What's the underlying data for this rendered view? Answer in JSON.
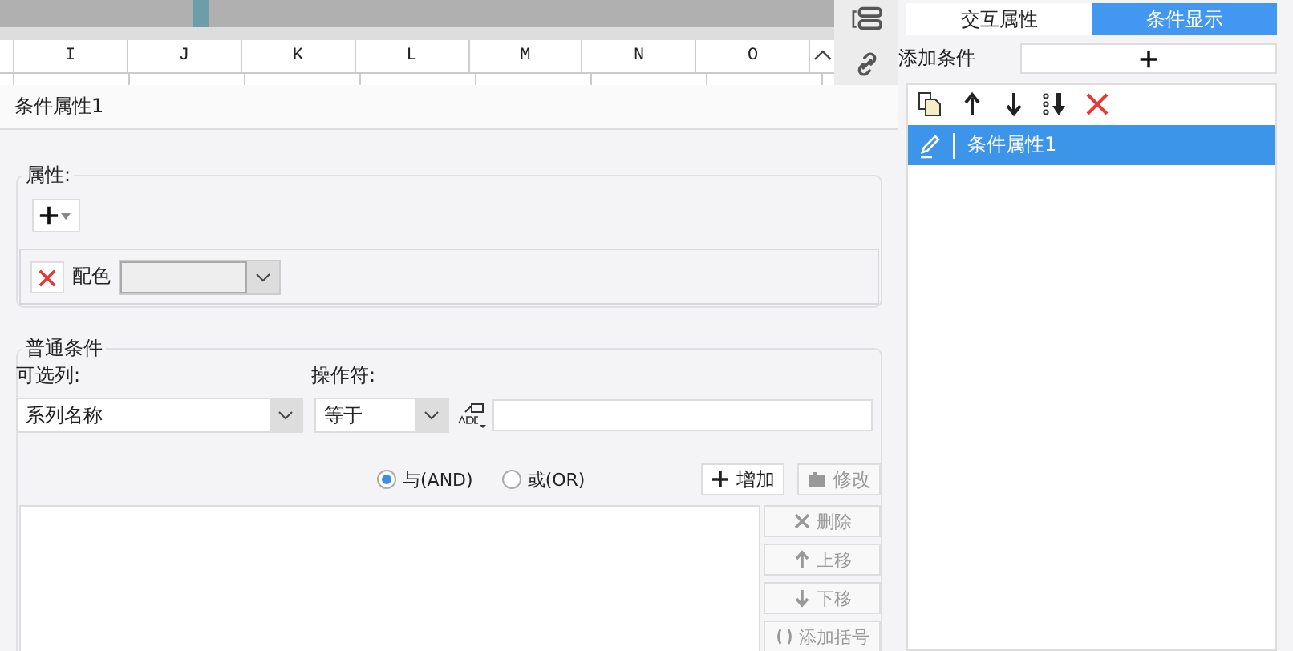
{
  "spreadsheet": {
    "columns": [
      "I",
      "J",
      "K",
      "L",
      "M",
      "N",
      "O"
    ]
  },
  "editor": {
    "title": "条件属性1",
    "attributes": {
      "legend": "属性:",
      "items": [
        {
          "name": "配色"
        }
      ]
    },
    "common_condition": {
      "legend": "普通条件",
      "column_label": "可选列:",
      "column_value": "系列名称",
      "operator_label": "操作符:",
      "operator_value": "等于",
      "logic": [
        {
          "label": "与(AND)",
          "selected": true
        },
        {
          "label": "或(OR)",
          "selected": false
        }
      ],
      "buttons": [
        {
          "label": "增加",
          "kind": "plus",
          "disabled": false
        },
        {
          "label": "修改",
          "kind": "block",
          "disabled": true
        }
      ],
      "list_buttons": [
        {
          "label": "删除",
          "kind": "cross",
          "disabled": true
        },
        {
          "label": "上移",
          "kind": "up",
          "disabled": true
        },
        {
          "label": "下移",
          "kind": "down",
          "disabled": true
        },
        {
          "label": "添加括号",
          "kind": "brackets",
          "disabled": true
        }
      ]
    }
  },
  "right_panel": {
    "tabs": [
      {
        "label": "交互属性",
        "selected": false
      },
      {
        "label": "条件显示",
        "selected": true
      }
    ],
    "add_label": "添加条件",
    "conditions": [
      {
        "label": "条件属性1",
        "selected": true
      }
    ]
  }
}
